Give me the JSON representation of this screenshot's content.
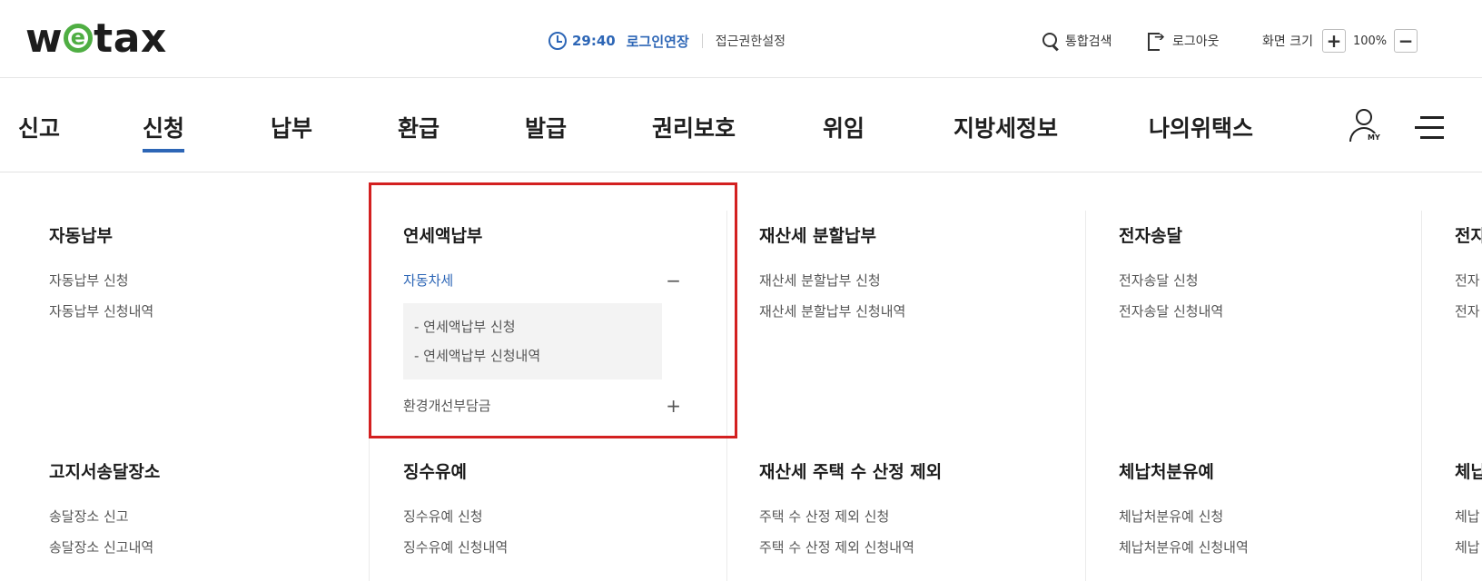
{
  "header": {
    "logo_text": "wetax",
    "session_time": "29:40",
    "extend_label": "로그인연장",
    "access_label": "접근권한설정",
    "search_label": "통합검색",
    "logout_label": "로그아웃",
    "zoom_label": "화면 크기",
    "zoom_in": "+",
    "zoom_value": "100%",
    "zoom_out": "−"
  },
  "nav": {
    "items": [
      "신고",
      "신청",
      "납부",
      "환급",
      "발급",
      "권리보호",
      "위임",
      "지방세정보",
      "나의위택스"
    ],
    "active": "신청",
    "my_label": "MY"
  },
  "menu": {
    "col1": {
      "g1": {
        "title": "자동납부",
        "links": [
          "자동납부 신청",
          "자동납부 신청내역"
        ]
      },
      "g2": {
        "title": "고지서송달장소",
        "links": [
          "송달장소 신고",
          "송달장소 신고내역"
        ]
      }
    },
    "col2": {
      "g1": {
        "title": "연세액납부",
        "sub1": {
          "label": "자동차세",
          "toggle": "−",
          "links": [
            "- 연세액납부 신청",
            "- 연세액납부 신청내역"
          ]
        },
        "sub2": {
          "label": "환경개선부담금",
          "toggle": "+"
        }
      },
      "g2": {
        "title": "징수유예",
        "links": [
          "징수유예 신청",
          "징수유예 신청내역"
        ]
      }
    },
    "col3": {
      "g1": {
        "title": "재산세 분할납부",
        "links": [
          "재산세 분할납부 신청",
          "재산세 분할납부 신청내역"
        ]
      },
      "g2": {
        "title": "재산세 주택 수 산정 제외",
        "links": [
          "주택 수 산정 제외 신청",
          "주택 수 산정 제외 신청내역"
        ]
      }
    },
    "col4": {
      "g1": {
        "title": "전자송달",
        "links": [
          "전자송달 신청",
          "전자송달 신청내역"
        ]
      },
      "g2": {
        "title": "체납처분유예",
        "links": [
          "체납처분유예 신청",
          "체납처분유예 신청내역"
        ]
      }
    },
    "col5": {
      "g1": {
        "title": "전자",
        "links": [
          "전자",
          "전자"
        ]
      },
      "g2": {
        "title": "체납",
        "links": [
          "체납",
          "체납"
        ]
      }
    }
  },
  "colors": {
    "accent": "#2d66b6",
    "highlight": "#d32020",
    "logo_green": "#4fae43"
  }
}
